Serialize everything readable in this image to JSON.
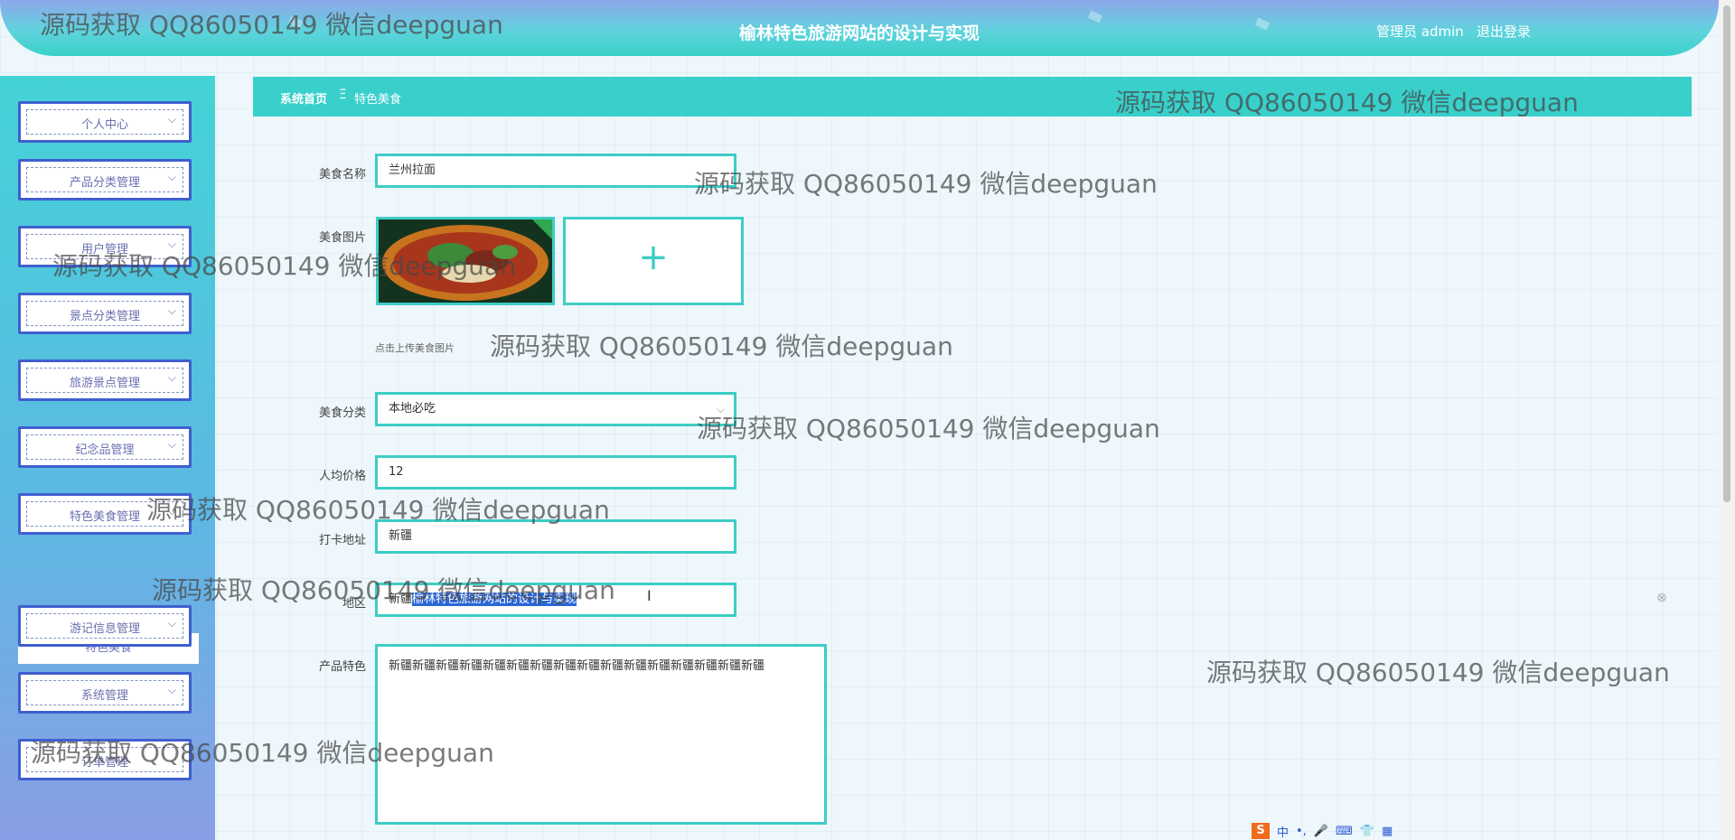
{
  "header": {
    "title": "榆林特色旅游网站的设计与实现",
    "user": "管理员 admin",
    "logout": "退出登录"
  },
  "sidebar": {
    "items": [
      {
        "label": "个人中心"
      },
      {
        "label": "产品分类管理"
      },
      {
        "label": "用户管理"
      },
      {
        "label": "景点分类管理"
      },
      {
        "label": "旅游景点管理"
      },
      {
        "label": "纪念品管理"
      },
      {
        "label": "特色美食管理"
      },
      {
        "label": "游记信息管理"
      },
      {
        "label": "系统管理"
      },
      {
        "label": "订单管理"
      }
    ],
    "active_sub": "特色美食"
  },
  "breadcrumb": {
    "home": "系统首页",
    "separator": "Ξ",
    "current": "特色美食"
  },
  "form": {
    "name": {
      "label": "美食名称",
      "value": "兰州拉面"
    },
    "image": {
      "label": "美食图片",
      "hint": "点击上传美食图片",
      "upload_symbol": "+"
    },
    "category": {
      "label": "美食分类",
      "value": "本地必吃"
    },
    "price": {
      "label": "人均价格",
      "value": "12"
    },
    "address": {
      "label": "打卡地址",
      "value": "新疆"
    },
    "region": {
      "label": "地区",
      "value_prefix": "新疆",
      "value_selected": "榆林特色旅游网站的设计与实现"
    },
    "feature": {
      "label": "产品特色",
      "value": "新疆新疆新疆新疆新疆新疆新疆新疆新疆新疆新疆新疆新疆新疆新疆新疆"
    }
  },
  "watermark": {
    "text": "源码获取 QQ86050149 微信deepguan"
  },
  "ime": {
    "labels": [
      "S",
      "中",
      "•,",
      "🎤",
      "⌨",
      "👕",
      "▦"
    ]
  }
}
